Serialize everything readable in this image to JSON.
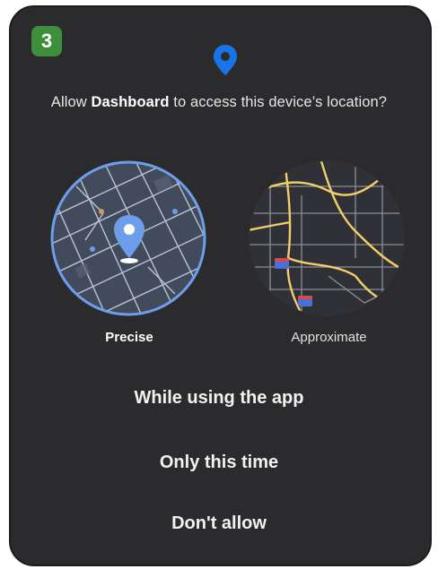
{
  "step_badge": "3",
  "dialog": {
    "question_prefix": "Allow ",
    "app_name": "Dashboard",
    "question_suffix": " to access this device’s location?"
  },
  "location_options": [
    {
      "label": "Precise",
      "selected": true,
      "icon": "precise-map-icon"
    },
    {
      "label": "Approximate",
      "selected": false,
      "icon": "approximate-map-icon"
    }
  ],
  "choices": [
    {
      "label": "While using the app"
    },
    {
      "label": "Only this time"
    },
    {
      "label": "Don't allow"
    }
  ],
  "colors": {
    "dialog_bg": "#2b2b2e",
    "accent": "#6d9eeb",
    "pin_blue": "#1a73e8",
    "badge_green": "#3e8f3c",
    "road_yellow": "#f2cf6b"
  }
}
